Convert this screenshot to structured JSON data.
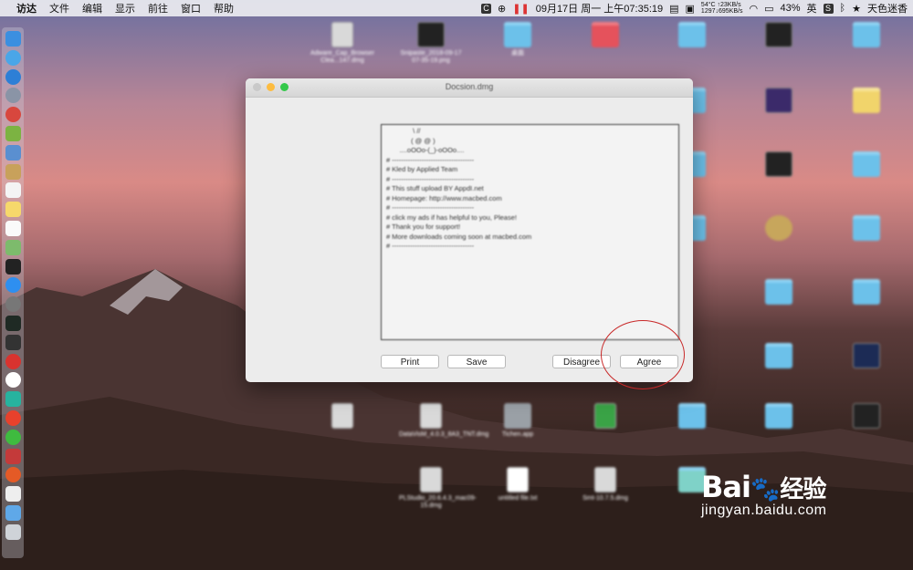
{
  "menubar": {
    "apple": "",
    "items": [
      "访达",
      "文件",
      "编辑",
      "显示",
      "前往",
      "窗口",
      "帮助"
    ],
    "datetime": "09月17日 周一 上午07:35:19",
    "temp": "54°C",
    "net_up": "↑23KB/s",
    "net_down": "1297↓695KB/s",
    "battery": "43%",
    "input_method": "英",
    "user": "天色迷香"
  },
  "window": {
    "title": "Docsion.dmg",
    "license_lines": [
      "              \\ //",
      "             ( @ @ )",
      "       ....oOOo-(_)-oOOo....",
      "# ------------------------------------",
      "# Kled by Applied Team",
      "# ------------------------------------",
      "# This stuff upload BY AppdI.net",
      "# Homepage: http://www.macbed.com",
      "# ------------------------------------",
      "# click my ads if has helpful to you, Please!",
      "# Thank you for support!",
      "# More downloads coming soon at macbed.com",
      "# ------------------------------------"
    ],
    "buttons": {
      "print": "Print",
      "save": "Save",
      "disagree": "Disagree",
      "agree": "Agree"
    }
  },
  "desktop_files": [
    {
      "label": "Adware_Cap_Browser Clea...147.dmg"
    },
    {
      "label": "Snipaste_2018-09-17 07-35-19.png"
    },
    {
      "label": "桌面"
    },
    {
      "label": "DataVisM_4.0.3_8A3_TNT.dmg"
    },
    {
      "label": "Tichen.app"
    },
    {
      "label": "untitled file.txt"
    },
    {
      "label": "Smt-10.7.5.dmg"
    },
    {
      "label": "PLStudio_20.6.4.3_mac09-15.dmg"
    }
  ],
  "watermark": {
    "brand": "Bai",
    "brand2": "经验",
    "url": "jingyan.baidu.com"
  },
  "colors": {
    "annotation_circle": "#c82828",
    "close": "#fc605c",
    "minimize": "#fdbc40",
    "zoom": "#34c84a"
  }
}
